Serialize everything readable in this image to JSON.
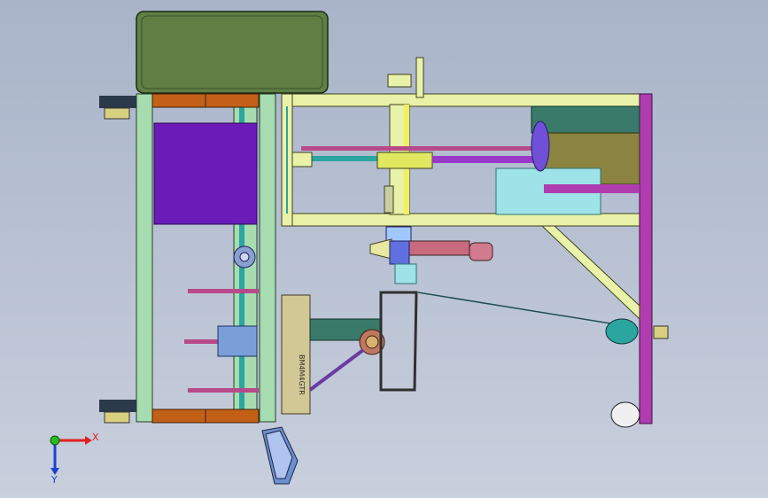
{
  "viewport": {
    "background_top": "#a9b4c9",
    "background_bottom": "#c8cfdd"
  },
  "triad": {
    "x_label": "X",
    "y_label": "Y",
    "x_color": "#e02020",
    "y_color": "#2040d0",
    "origin_color": "#20c020"
  },
  "part_label": "BM4M4GTR",
  "colors": {
    "frame_green": "#a6dcb0",
    "frame_yellow": "#e8f2a8",
    "motor_green": "#5f7f45",
    "purple_panel": "#6a1bb8",
    "orange_bar": "#c26018",
    "magenta_rail": "#b03cb0",
    "olive_box": "#8a8440",
    "teal_slide": "#2aa5a0",
    "light_cyan": "#9ee3e8",
    "pink_tool": "#d27a8e",
    "tan_box": "#d2c896"
  }
}
